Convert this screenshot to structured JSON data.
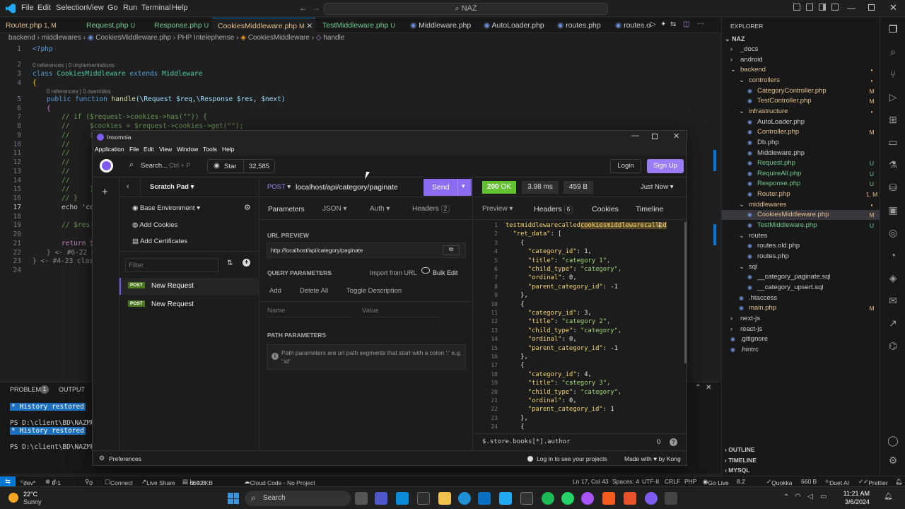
{
  "vscode": {
    "menu": [
      "File",
      "Edit",
      "Selection",
      "View",
      "Go",
      "Run",
      "Terminal",
      "Help"
    ],
    "search_text": "NAZ",
    "tabs": [
      {
        "label": "Router.php",
        "status": "1, M",
        "color": "#e2c08d"
      },
      {
        "label": "Request.php",
        "status": "U",
        "color": "#73c991"
      },
      {
        "label": "Response.php",
        "status": "U",
        "color": "#73c991"
      },
      {
        "label": "CookiesMiddleware.php",
        "status": "M",
        "color": "#e2c08d"
      },
      {
        "label": "TestMiddleware.php",
        "status": "U",
        "color": "#73c991"
      },
      {
        "label": "Middleware.php",
        "status": "",
        "color": "#9cdcfe"
      },
      {
        "label": "AutoLoader.php",
        "status": "",
        "color": "#9cdcfe"
      },
      {
        "label": "routes.php",
        "status": "",
        "color": "#9cdcfe"
      },
      {
        "label": "routes.ol",
        "status": "",
        "color": "#9cdcfe"
      }
    ],
    "breadcrumb": [
      "backend",
      "middlewares",
      "CookiesMiddleware.php",
      "PHP Intelephense",
      "CookiesMiddleware",
      "handle"
    ],
    "code": {
      "line_numbers": [
        "1",
        "2",
        "3",
        "4",
        "5",
        "6",
        "7",
        "8",
        "9",
        "10",
        "11",
        "12",
        "13",
        "14",
        "15",
        "16",
        "17",
        "18",
        "19",
        "20",
        "21",
        "22",
        "23",
        "24"
      ],
      "open_tag": "<?php",
      "refs1": "0 references | 0 implementations",
      "class_kw": "class",
      "class_name": "CookiesMiddleware",
      "extends_kw": "extends",
      "parent": "Middleware",
      "brace_open": "{",
      "refs2": "0 references | 0 overrides",
      "public_kw": "public",
      "function_kw": "function",
      "fn_name": "handle",
      "params": "(\\Request $req,\\Response $res, $next)",
      "inner_brace": "{",
      "l7": "// if ($request->cookies->has(\"\")) {",
      "l8": "//     $cookies = $request->cookies->get(\"\");",
      "l9": "//     i",
      "l10": "//",
      "l11": "//",
      "l12": "//",
      "l13": "//",
      "l14": "//",
      "l15": "//     }",
      "l16": "// }",
      "l17": "echo 'co",
      "l19": "// $res-",
      "l21": "return $",
      "l22": "} <- #6-22 p",
      "l23": "} <- #4-23 class"
    },
    "panel": {
      "tabs": [
        "PROBLEMS",
        "OUTPUT"
      ],
      "problems_count": "1",
      "history": "* History restored",
      "prompt1": "PS D:\\client\\BD\\NAZMUS_SA",
      "prompt2": "PS D:\\client\\BD\\NAZMUS_SA"
    },
    "explorer": {
      "title": "EXPLORER",
      "root": "NAZ",
      "items": [
        {
          "label": "_docs",
          "depth": 1,
          "folder": true,
          "open": false,
          "color": "#ccc",
          "status": ""
        },
        {
          "label": "android",
          "depth": 1,
          "folder": true,
          "open": false,
          "color": "#ccc",
          "status": ""
        },
        {
          "label": "backend",
          "depth": 1,
          "folder": true,
          "open": true,
          "color": "#e2c08d",
          "status": "•"
        },
        {
          "label": "controllers",
          "depth": 2,
          "folder": true,
          "open": true,
          "color": "#e2c08d",
          "status": "•"
        },
        {
          "label": "CategoryController.php",
          "depth": 3,
          "folder": false,
          "color": "#e2c08d",
          "status": "M"
        },
        {
          "label": "TestController.php",
          "depth": 3,
          "folder": false,
          "color": "#e2c08d",
          "status": "M"
        },
        {
          "label": "infrastructure",
          "depth": 2,
          "folder": true,
          "open": true,
          "color": "#e2c08d",
          "status": "•"
        },
        {
          "label": "AutoLoader.php",
          "depth": 3,
          "folder": false,
          "color": "#ccc",
          "status": ""
        },
        {
          "label": "Controller.php",
          "depth": 3,
          "folder": false,
          "color": "#e2c08d",
          "status": "M"
        },
        {
          "label": "Db.php",
          "depth": 3,
          "folder": false,
          "color": "#ccc",
          "status": ""
        },
        {
          "label": "Middleware.php",
          "depth": 3,
          "folder": false,
          "color": "#ccc",
          "status": ""
        },
        {
          "label": "Request.php",
          "depth": 3,
          "folder": false,
          "color": "#73c991",
          "status": "U"
        },
        {
          "label": "RequireAll.php",
          "depth": 3,
          "folder": false,
          "color": "#73c991",
          "status": "U"
        },
        {
          "label": "Response.php",
          "depth": 3,
          "folder": false,
          "color": "#73c991",
          "status": "U"
        },
        {
          "label": "Router.php",
          "depth": 3,
          "folder": false,
          "color": "#e2c08d",
          "status": "1, M"
        },
        {
          "label": "middlewares",
          "depth": 2,
          "folder": true,
          "open": true,
          "color": "#e2c08d",
          "status": "•"
        },
        {
          "label": "CookiesMiddleware.php",
          "depth": 3,
          "folder": false,
          "color": "#e2c08d",
          "status": "M",
          "selected": true
        },
        {
          "label": "TestMiddleware.php",
          "depth": 3,
          "folder": false,
          "color": "#73c991",
          "status": "U"
        },
        {
          "label": "routes",
          "depth": 2,
          "folder": true,
          "open": true,
          "color": "#ccc",
          "status": ""
        },
        {
          "label": "routes.old.php",
          "depth": 3,
          "folder": false,
          "color": "#ccc",
          "status": ""
        },
        {
          "label": "routes.php",
          "depth": 3,
          "folder": false,
          "color": "#ccc",
          "status": ""
        },
        {
          "label": "sql",
          "depth": 2,
          "folder": true,
          "open": true,
          "color": "#ccc",
          "status": ""
        },
        {
          "label": "__category_paginate.sql",
          "depth": 3,
          "folder": false,
          "color": "#ccc",
          "status": ""
        },
        {
          "label": "__category_upsert.sql",
          "depth": 3,
          "folder": false,
          "color": "#ccc",
          "status": ""
        },
        {
          "label": ".htaccess",
          "depth": 2,
          "folder": false,
          "color": "#ccc",
          "status": ""
        },
        {
          "label": "main.php",
          "depth": 2,
          "folder": false,
          "color": "#e2c08d",
          "status": "M"
        },
        {
          "label": "next-js",
          "depth": 1,
          "folder": true,
          "open": false,
          "color": "#ccc",
          "status": ""
        },
        {
          "label": "react-js",
          "depth": 1,
          "folder": true,
          "open": false,
          "color": "#ccc",
          "status": ""
        },
        {
          "label": ".gitignore",
          "depth": 1,
          "folder": false,
          "color": "#ccc",
          "status": ""
        },
        {
          "label": ".hintrc",
          "depth": 1,
          "folder": false,
          "color": "#ccc",
          "status": ""
        }
      ],
      "sections": [
        "OUTLINE",
        "TIMELINE",
        "MYSQL"
      ]
    },
    "status": {
      "branch": "dev*",
      "errors": "0",
      "warnings": "1",
      "ports": "0",
      "connect": "Connect",
      "live_share": "Live Share",
      "size1": "660 B",
      "size2": "1.42 KB",
      "cloud": "Cloud Code - No Project",
      "position": "Ln 17, Col 43",
      "spaces": "Spaces: 4",
      "encoding": "UTF-8",
      "eol": "CRLF",
      "lang": "PHP",
      "golive": "Go Live",
      "ver": "8.2",
      "quokka": "Quokka",
      "size3": "660 B",
      "duet": "Duet AI",
      "prettier": "Prettier"
    }
  },
  "taskbar": {
    "temp": "22°C",
    "weather": "Sunny",
    "search": "Search",
    "time": "11:21 AM",
    "date": "3/6/2024"
  },
  "insomnia": {
    "title": "Insomnia",
    "menu": [
      "Application",
      "File",
      "Edit",
      "View",
      "Window",
      "Tools",
      "Help"
    ],
    "search_label": "Search...",
    "search_shortcut": "Ctrl + P",
    "star_label": "Star",
    "star_count": "32,585",
    "login": "Login",
    "signup": "Sign Up",
    "scratch_pad": "Scratch Pad",
    "base_env": "Base Environment",
    "add_cookies": "Add Cookies",
    "add_certificates": "Add Certificates",
    "filter_placeholder": "Filter",
    "requests": [
      {
        "method": "POST",
        "name": "New Request"
      },
      {
        "method": "POST",
        "name": "New Request"
      }
    ],
    "preferences": "Preferences",
    "method": "POST",
    "url": "localhost/api/category/paginate",
    "send": "Send",
    "req_tabs": {
      "parameters": "Parameters",
      "json": "JSON",
      "auth": "Auth",
      "headers": "Headers",
      "headers_count": "2"
    },
    "url_preview_label": "URL PREVIEW",
    "url_preview": "http://localhost/api/category/paginate",
    "query_params_label": "QUERY PARAMETERS",
    "import_url": "Import from URL",
    "bulk_edit": "Bulk Edit",
    "add": "Add",
    "delete_all": "Delete All",
    "toggle_desc": "Toggle Description",
    "name_placeholder": "Name",
    "value_placeholder": "Value",
    "path_params_label": "PATH PARAMETERS",
    "path_params_info": "Path parameters are url path segments that start with a colon ':' e.g. ':id'",
    "status_code": "200",
    "status_text": "OK",
    "time": "3.98 ms",
    "size": "459 B",
    "when": "Just Now",
    "resp_tabs": {
      "preview": "Preview",
      "headers": "Headers",
      "headers_count": "6",
      "cookies": "Cookies",
      "timeline": "Timeline"
    },
    "filter_expr": "$.store.books[*].author",
    "filter_count": "0",
    "logged": "Log in to see your projects",
    "made_with": "Made with",
    "by_kong": "by Kong",
    "json_prefix": "testmiddlewarecalled",
    "json_highlight": "cookiesmiddlewarecalled",
    "json_lines": [
      {
        "n": "1",
        "txt": "{"
      },
      {
        "n": "2",
        "txt": "  \"ret_data\": ["
      },
      {
        "n": "3",
        "txt": "    {"
      },
      {
        "n": "4",
        "txt": "      \"category_id\": 1,"
      },
      {
        "n": "5",
        "txt": "      \"title\": \"category 1\","
      },
      {
        "n": "6",
        "txt": "      \"child_type\": \"category\","
      },
      {
        "n": "7",
        "txt": "      \"ordinal\": 0,"
      },
      {
        "n": "8",
        "txt": "      \"parent_category_id\": -1"
      },
      {
        "n": "9",
        "txt": "    },"
      },
      {
        "n": "10",
        "txt": "    {"
      },
      {
        "n": "11",
        "txt": "      \"category_id\": 3,"
      },
      {
        "n": "12",
        "txt": "      \"title\": \"category 2\","
      },
      {
        "n": "13",
        "txt": "      \"child_type\": \"category\","
      },
      {
        "n": "14",
        "txt": "      \"ordinal\": 0,"
      },
      {
        "n": "15",
        "txt": "      \"parent_category_id\": -1"
      },
      {
        "n": "16",
        "txt": "    },"
      },
      {
        "n": "17",
        "txt": "    {"
      },
      {
        "n": "18",
        "txt": "      \"category_id\": 4,"
      },
      {
        "n": "19",
        "txt": "      \"title\": \"category 3\","
      },
      {
        "n": "20",
        "txt": "      \"child_type\": \"category\","
      },
      {
        "n": "21",
        "txt": "      \"ordinal\": 0,"
      },
      {
        "n": "22",
        "txt": "      \"parent_category_id\": 1"
      },
      {
        "n": "23",
        "txt": "    },"
      },
      {
        "n": "24",
        "txt": "    {"
      }
    ]
  },
  "colors": {
    "accent_purple": "#7e5bef",
    "send": "#8c6df2",
    "ok": "#63c132",
    "vscode_blue": "#0078d4"
  }
}
